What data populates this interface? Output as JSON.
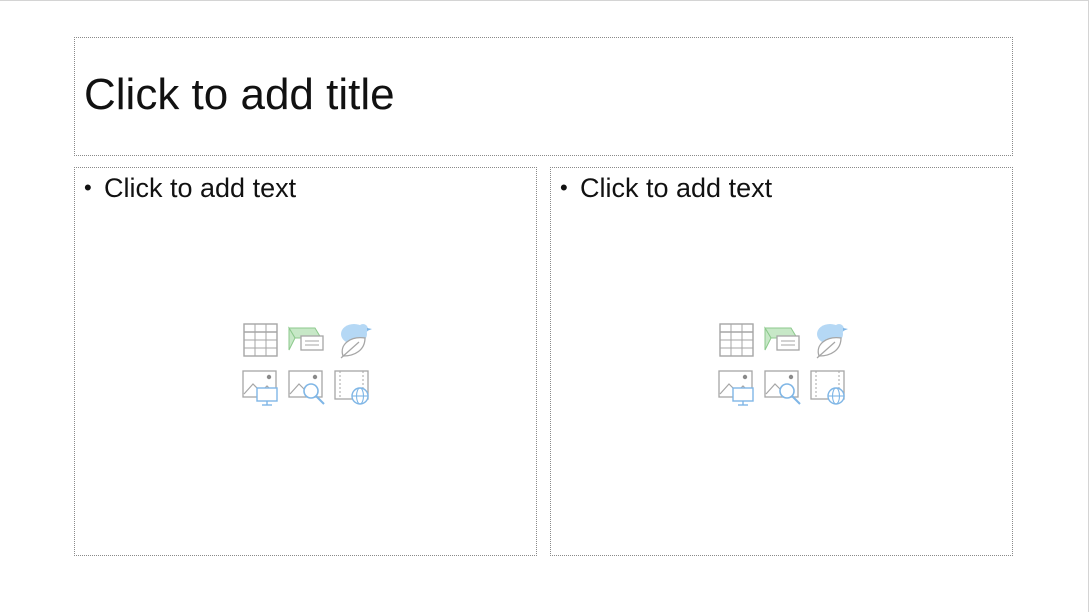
{
  "slide": {
    "title_placeholder": "Click to add title",
    "left_content": {
      "bullet": "•",
      "text_placeholder": "Click to add text",
      "insert_icons": [
        "insert-table-icon",
        "insert-chart-icon",
        "insert-smartart-icon",
        "insert-picture-icon",
        "insert-online-picture-icon",
        "insert-video-icon"
      ]
    },
    "right_content": {
      "bullet": "•",
      "text_placeholder": "Click to add text",
      "insert_icons": [
        "insert-table-icon",
        "insert-chart-icon",
        "insert-smartart-icon",
        "insert-picture-icon",
        "insert-online-picture-icon",
        "insert-video-icon"
      ]
    }
  },
  "colors": {
    "placeholder_border": "#8a8a8a",
    "icon_gray": "#a6a6a6",
    "icon_green": "#bfe3bf",
    "icon_blue": "#9dc9ee",
    "text": "#111111"
  }
}
